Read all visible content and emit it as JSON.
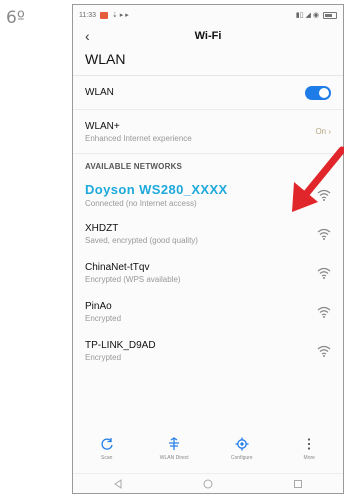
{
  "step": "6º",
  "status_bar": {
    "time": "11:33"
  },
  "header": {
    "back_glyph": "‹",
    "title": "Wi-Fi"
  },
  "page_heading": "WLAN",
  "wlan_toggle": {
    "label": "WLAN",
    "on": true
  },
  "wlan_plus": {
    "label": "WLAN+",
    "sublabel": "Enhanced Internet experience",
    "value": "On"
  },
  "section_header": "AVAILABLE NETWORKS",
  "networks": [
    {
      "name": "Doyson WS280_XXXX",
      "status": "Connected (no Internet access)"
    },
    {
      "name": "XHDZT",
      "status": "Saved, encrypted (good quality)"
    },
    {
      "name": "ChinaNet-tTqv",
      "status": "Encrypted (WPS available)"
    },
    {
      "name": "PinAo",
      "status": "Encrypted"
    },
    {
      "name": "TP-LINK_D9AD",
      "status": "Encrypted"
    }
  ],
  "toolbar": [
    {
      "label": "Scan",
      "icon": "refresh-icon"
    },
    {
      "label": "WLAN Direct",
      "icon": "wlan-direct-icon"
    },
    {
      "label": "Configure",
      "icon": "gear-icon"
    },
    {
      "label": "More",
      "icon": "more-vertical-icon"
    }
  ],
  "colors": {
    "accent": "#1e7ce8",
    "highlight": "#1ea9dc",
    "arrow": "#e1262b"
  }
}
